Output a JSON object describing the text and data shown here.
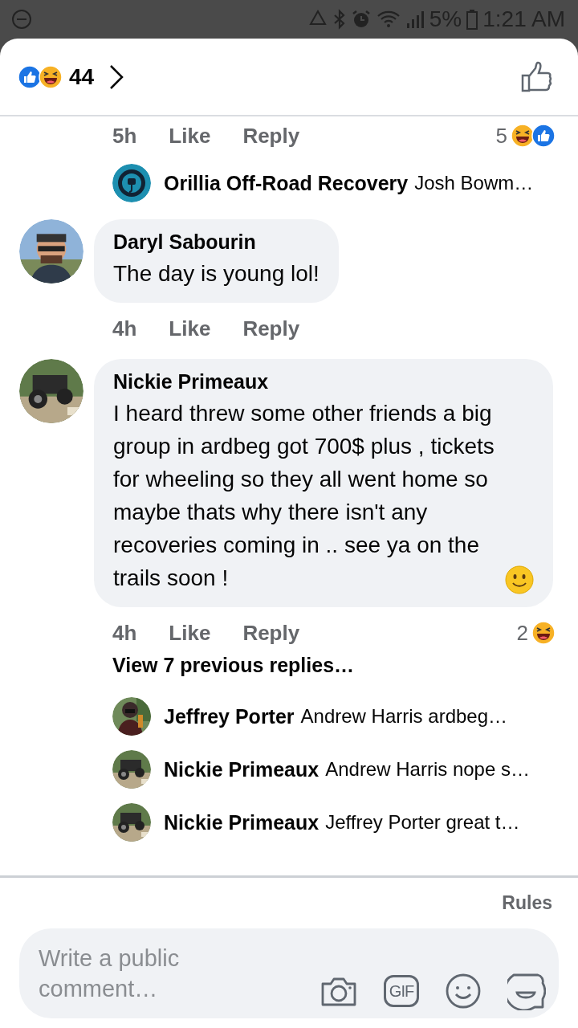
{
  "status_bar": {
    "battery": "5%",
    "time": "1:21 AM"
  },
  "header": {
    "reactions": [
      {
        "kind": "like"
      },
      {
        "kind": "haha"
      }
    ],
    "count": "44"
  },
  "items": [
    {
      "kind": "actions",
      "time": "5h",
      "like": "Like",
      "reply": "Reply",
      "reaction_count": "5",
      "reactions": [
        {
          "kind": "haha"
        },
        {
          "kind": "like"
        }
      ]
    },
    {
      "kind": "reply_preview",
      "name": "Orillia Off-Road Recovery",
      "text": "Josh Bowm…"
    },
    {
      "kind": "comment",
      "name": "Daryl Sabourin",
      "text": "The day is young lol!"
    },
    {
      "kind": "actions",
      "time": "4h",
      "like": "Like",
      "reply": "Reply"
    },
    {
      "kind": "comment",
      "name": "Nickie Primeaux",
      "text": "I heard threw some other friends a big group in ardbeg got 700$ plus , tickets for wheeling so they all went home so maybe thats why there isn't any recoveries coming in .. see ya on the trails soon !",
      "emoji": {
        "kind": "smile"
      }
    },
    {
      "kind": "actions",
      "time": "4h",
      "like": "Like",
      "reply": "Reply",
      "reaction_count": "2",
      "reactions": [
        {
          "kind": "haha"
        }
      ]
    },
    {
      "kind": "view_more",
      "label": "View 7 previous replies…"
    },
    {
      "kind": "reply_preview",
      "name": "Jeffrey Porter",
      "text": "Andrew Harris  ardbeg…"
    },
    {
      "kind": "reply_preview",
      "name": "Nickie Primeaux",
      "text": "Andrew Harris nope s…"
    },
    {
      "kind": "reply_preview",
      "name": "Nickie Primeaux",
      "text": "Jeffrey Porter great t…"
    }
  ],
  "footer": {
    "rules": "Rules",
    "placeholder": "Write a public comment…",
    "gif": "GIF"
  }
}
